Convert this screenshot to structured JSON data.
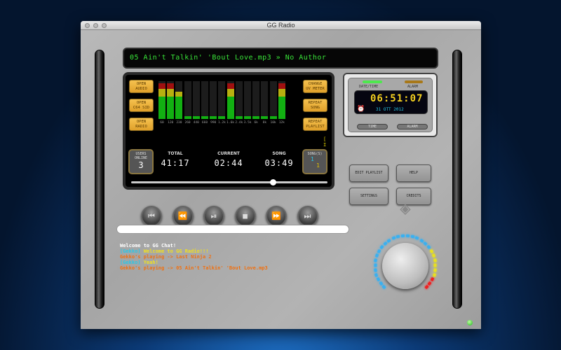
{
  "window": {
    "title": "GG Radio"
  },
  "now_playing": "05 Ain't Talkin' 'Bout Love.mp3 » No Author",
  "left_buttons": [
    "OPEN\nAUDIO",
    "OPEN\nC64 SID",
    "OPEN\nRADIO"
  ],
  "right_buttons": [
    "CHANGE\nUV METER",
    "REPEAT\nSONG",
    "REPEAT\nPLAYLIST"
  ],
  "equalizer": {
    "bands": [
      "60",
      "120",
      "230",
      "260",
      "440",
      "660",
      "990",
      "1.2k",
      "1.6k",
      "2.4k",
      "3.5k",
      "6k",
      "8k",
      "10k",
      "12k"
    ],
    "levels": [
      0.95,
      0.95,
      0.72,
      0.08,
      0.08,
      0.08,
      0.08,
      0.08,
      0.95,
      0.08,
      0.08,
      0.08,
      0.08,
      0.08,
      0.95
    ],
    "colors": {
      "green": "#12b012",
      "yellow": "#b8b010",
      "red": "#a01010"
    }
  },
  "buffer_indicator": "[ I",
  "users_online": {
    "label": "USERS ONLINE",
    "value": "3"
  },
  "stats": [
    {
      "label": "TOTAL",
      "value": "41:17"
    },
    {
      "label": "CURRENT",
      "value": "02:44"
    },
    {
      "label": "SONG",
      "value": "03:49"
    }
  ],
  "songs": {
    "label": "SONG(S)",
    "current": "1",
    "total": "1"
  },
  "progress": 0.72,
  "clock": {
    "tab_datetime": "DATE/TIME",
    "tab_alarm": "ALARM",
    "time": "06:51:07",
    "date": "31 OTT 2012",
    "btn_time": "TIME",
    "btn_alarm": "ALARM"
  },
  "menu_buttons": [
    "EDIT PLAYLIST",
    "HELP",
    "SETTINGS",
    "CREDITS"
  ],
  "transport": [
    {
      "name": "previous-track",
      "glyph": "⏮"
    },
    {
      "name": "rewind",
      "glyph": "⏪"
    },
    {
      "name": "play-pause",
      "glyph": "⏯"
    },
    {
      "name": "stop",
      "glyph": "■"
    },
    {
      "name": "fast-forward",
      "glyph": "⏩"
    },
    {
      "name": "next-track",
      "glyph": "⏭"
    }
  ],
  "chat_input": {
    "value": ""
  },
  "chat": [
    [
      {
        "t": "Welcome to GG Chat!",
        "c": "#ffffff"
      }
    ],
    [
      {
        "t": "[Gekko] ",
        "c": "#27c8e8"
      },
      {
        "t": "Welcome to GG Radio!!!",
        "c": "#f0e020"
      }
    ],
    [
      {
        "t": "Gekko's playing -> Last Ninja 2",
        "c": "#f07010"
      }
    ],
    [
      {
        "t": "[Gekko] ",
        "c": "#27c8e8"
      },
      {
        "t": "Yeah!",
        "c": "#f0e020"
      }
    ],
    [
      {
        "t": "Gekko's playing -> 05 Ain't Talkin' 'Bout Love.mp3",
        "c": "#f07010"
      }
    ]
  ],
  "volume": 0.85
}
